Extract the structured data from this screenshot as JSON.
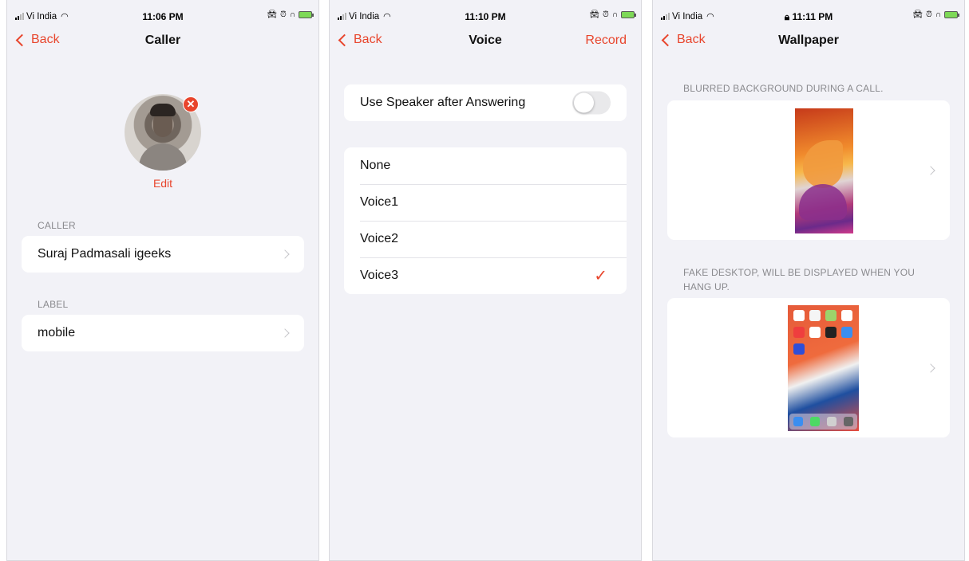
{
  "status_bars": [
    {
      "carrier": "Vi India",
      "time": "11:06 PM"
    },
    {
      "carrier": "Vi India",
      "time": "11:10 PM"
    },
    {
      "carrier": "Vi India",
      "time": "11:11 PM"
    }
  ],
  "caller_screen": {
    "back_label": "Back",
    "title": "Caller",
    "edit_label": "Edit",
    "caller_section": "CALLER",
    "caller_name": "Suraj Padmasali igeeks",
    "label_section": "LABEL",
    "label_value": "mobile"
  },
  "voice_screen": {
    "back_label": "Back",
    "title": "Voice",
    "action_label": "Record",
    "speaker_label": "Use Speaker after Answering",
    "speaker_on": false,
    "options": [
      "None",
      "Voice1",
      "Voice2",
      "Voice3"
    ],
    "selected": "Voice3"
  },
  "wallpaper_screen": {
    "back_label": "Back",
    "title": "Wallpaper",
    "blur_section": "BLURRED BACKGROUND DURING A CALL.",
    "fake_section": "FAKE DESKTOP, WILL BE DISPLAYED WHEN YOU HANG UP."
  },
  "colors": {
    "accent": "#e8452c",
    "background": "#f2f2f7",
    "card": "#ffffff"
  }
}
